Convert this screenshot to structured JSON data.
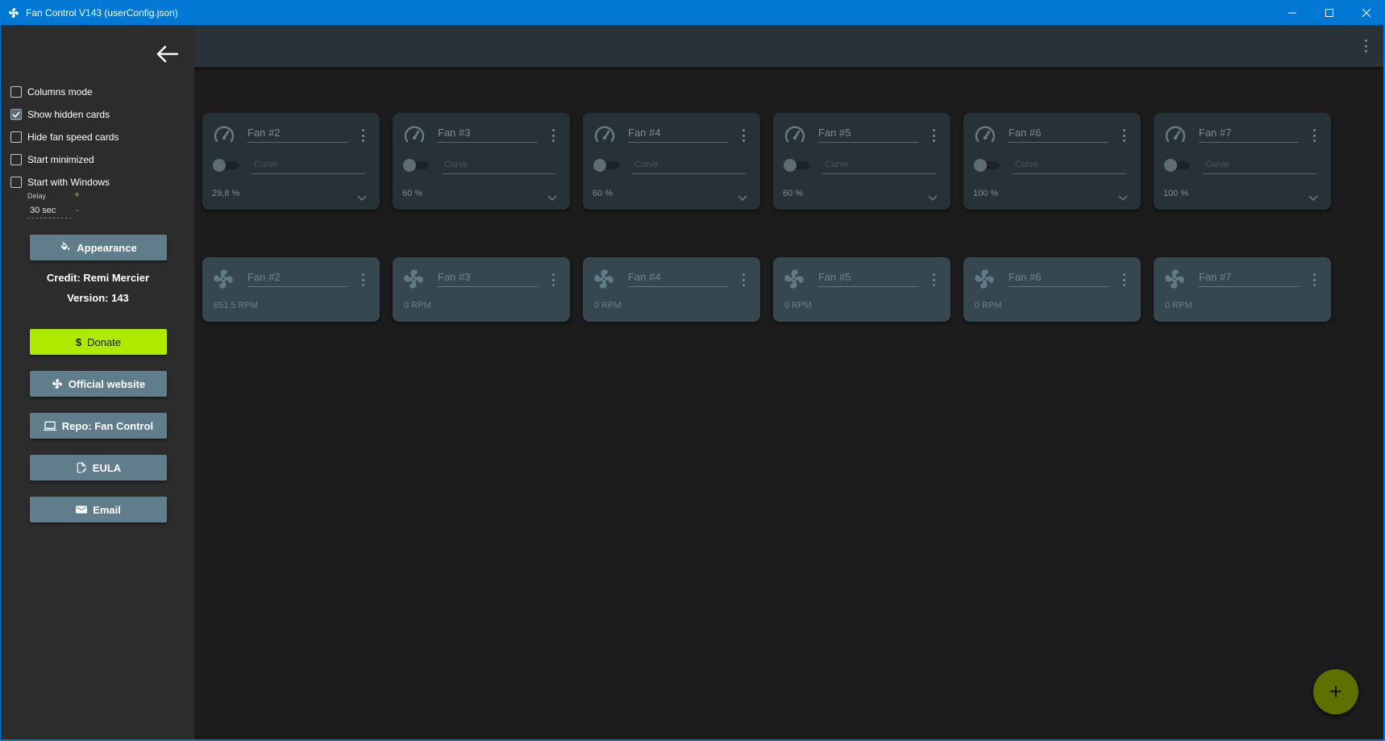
{
  "window": {
    "title": "Fan Control V143 (userConfig.json)"
  },
  "sidebar": {
    "options": [
      {
        "label": "Columns mode",
        "checked": false
      },
      {
        "label": "Show hidden cards",
        "checked": true
      },
      {
        "label": "Hide fan speed cards",
        "checked": false
      },
      {
        "label": "Start minimized",
        "checked": false
      },
      {
        "label": "Start with Windows",
        "checked": false
      }
    ],
    "delay": {
      "label": "Delay",
      "value": "30 sec",
      "plus": "+",
      "minus": "-"
    },
    "appearance_label": "Appearance",
    "credit": "Credit: Remi Mercier",
    "version": "Version: 143",
    "donate_label": "Donate",
    "donate_symbol": "$",
    "website_label": "Official website",
    "repo_label": "Repo: Fan Control",
    "eula_label": "EULA",
    "email_label": "Email"
  },
  "control_cards": [
    {
      "name": "Fan #2",
      "placeholder": "Curve",
      "value": "29,8 %"
    },
    {
      "name": "Fan #3",
      "placeholder": "Curve",
      "value": "60 %"
    },
    {
      "name": "Fan #4",
      "placeholder": "Curve",
      "value": "60 %"
    },
    {
      "name": "Fan #5",
      "placeholder": "Curve",
      "value": "60 %"
    },
    {
      "name": "Fan #6",
      "placeholder": "Curve",
      "value": "100 %"
    },
    {
      "name": "Fan #7",
      "placeholder": "Curve",
      "value": "100 %"
    }
  ],
  "speed_cards": [
    {
      "name": "Fan #2",
      "value": "651.5 RPM"
    },
    {
      "name": "Fan #3",
      "value": "0 RPM"
    },
    {
      "name": "Fan #4",
      "value": "0 RPM"
    },
    {
      "name": "Fan #5",
      "value": "0 RPM"
    },
    {
      "name": "Fan #6",
      "value": "0 RPM"
    },
    {
      "name": "Fan #7",
      "value": "0 RPM"
    }
  ],
  "fab_symbol": "+",
  "colors": {
    "titlebar": "#0078d4",
    "sidebar_button": "#607d8b",
    "donate": "#aeea00",
    "fab": "#5c7100"
  }
}
